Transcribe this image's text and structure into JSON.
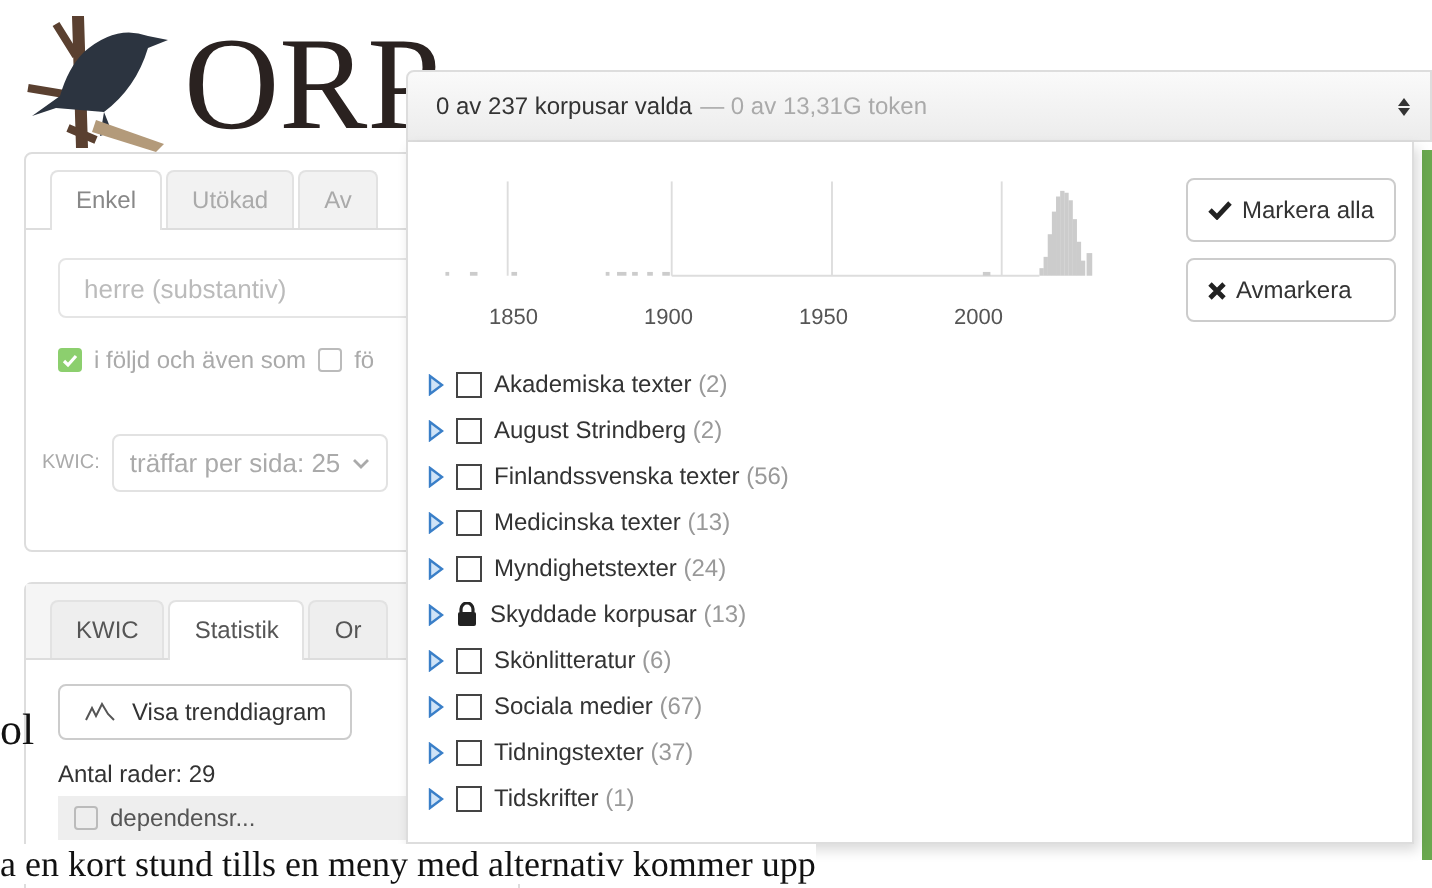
{
  "logo": {
    "text": "ORP"
  },
  "search": {
    "tabs": [
      {
        "label": "Enkel",
        "selected": true
      },
      {
        "label": "Utökad",
        "selected": false
      },
      {
        "label": "Av",
        "selected": false
      }
    ],
    "query": {
      "placeholder": "herre (substantiv)"
    },
    "options": [
      {
        "label": "i följd och även som",
        "checked": true
      },
      {
        "label": "fö",
        "checked": false
      }
    ],
    "kwic_label": "KWIC:",
    "per_page": "träffar per sida: 25"
  },
  "results": {
    "tabs": [
      {
        "label": "KWIC",
        "selected": false
      },
      {
        "label": "Statistik",
        "selected": true
      },
      {
        "label": "Or",
        "selected": false
      }
    ],
    "trend_button": "Visa trenddiagram",
    "row_count": "Antal rader: 29",
    "table": {
      "columns": [
        {
          "label": "dependensr...",
          "checked": false
        }
      ]
    }
  },
  "background_text": [
    "ol",
    "a en kort stund tills en meny med alternativ kommer upp"
  ],
  "corpus_selector": {
    "summary": "0 av 237 korpusar valda",
    "tokens": "— 0 av 13,31G token",
    "years": [
      "1850",
      "1900",
      "1950",
      "2000"
    ],
    "buttons": [
      {
        "kind": "check",
        "label": "Markera alla"
      },
      {
        "kind": "cross",
        "label": "Avmarkera"
      }
    ],
    "corpora": [
      {
        "kind": "checkbox",
        "name": "Akademiska texter",
        "count": "(2)",
        "checked": false
      },
      {
        "kind": "checkbox",
        "name": "August Strindberg",
        "count": "(2)",
        "checked": false
      },
      {
        "kind": "checkbox",
        "name": "Finlandssvenska texter",
        "count": "(56)",
        "checked": false
      },
      {
        "kind": "checkbox",
        "name": "Medicinska texter",
        "count": "(13)",
        "checked": false
      },
      {
        "kind": "checkbox",
        "name": "Myndighetstexter",
        "count": "(24)",
        "checked": false
      },
      {
        "kind": "locked",
        "name": "Skyddade korpusar",
        "count": "(13)"
      },
      {
        "kind": "checkbox",
        "name": "Skönlitteratur",
        "count": "(6)",
        "checked": false
      },
      {
        "kind": "checkbox",
        "name": "Sociala medier",
        "count": "(67)",
        "checked": false
      },
      {
        "kind": "checkbox",
        "name": "Tidningstexter",
        "count": "(37)",
        "checked": false
      },
      {
        "kind": "checkbox",
        "name": "Tidskrifter",
        "count": "(1)",
        "checked": false
      }
    ]
  }
}
